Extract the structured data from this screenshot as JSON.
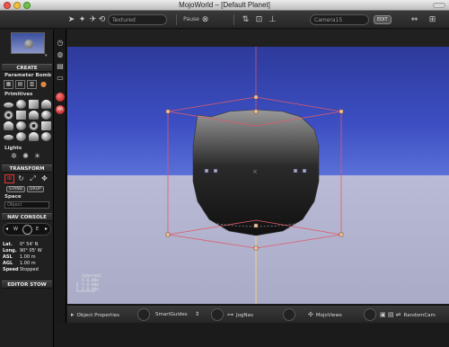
{
  "window": {
    "title": "MojoWorld – [Default Planet]"
  },
  "toolbar": {
    "render_mode": "Textured",
    "pause_label": "Pause",
    "camera_field": "Camera15",
    "edit_label": "EDIT",
    "icons": [
      "select-arrow-icon",
      "walk-icon",
      "fly-icon",
      "orbit-icon",
      "swap-icon",
      "snapshot-icon",
      "stamp-icon"
    ]
  },
  "sidebar": {
    "create_header": "CREATE",
    "param_bomb_label": "Parameter Bomb",
    "primitives_label": "Primitives",
    "lights_label": "Lights",
    "transform_header": "TRANSFORM",
    "stand_label": "STAND",
    "drop_label": "DROP",
    "space_label": "Space",
    "space_value": "Object",
    "nav_header": "NAV CONSOLE",
    "nav": {
      "lat_label": "Lat.",
      "lat_value": "0° 54' N",
      "long_label": "Long.",
      "long_value": "90° 05' W",
      "asl_label": "ASL",
      "asl_value": "1.00 m",
      "agl_label": "AGL",
      "agl_value": "1.00 m",
      "speed_label": "Speed",
      "speed_value": "Stopped"
    },
    "editor_stow_header": "EDITOR STOW",
    "compass": {
      "w": "W",
      "e": "E"
    }
  },
  "viewport": {
    "coords": [
      "Sphere02",
      "X  0.00m",
      "Y  0.00m",
      "Z  0.00m"
    ]
  },
  "bottombar": {
    "object_properties": "Object Properties",
    "smart_guides": "SmartGuides",
    "jognav": "JogNav",
    "mojoviews": "MojoViews",
    "randomcam": "RandomCam"
  },
  "colors": {
    "sky": "#3c4ec2",
    "ground": "#b2b4d0",
    "selection_box": "#e05a6a",
    "axis_guide": "#f2d27a"
  }
}
